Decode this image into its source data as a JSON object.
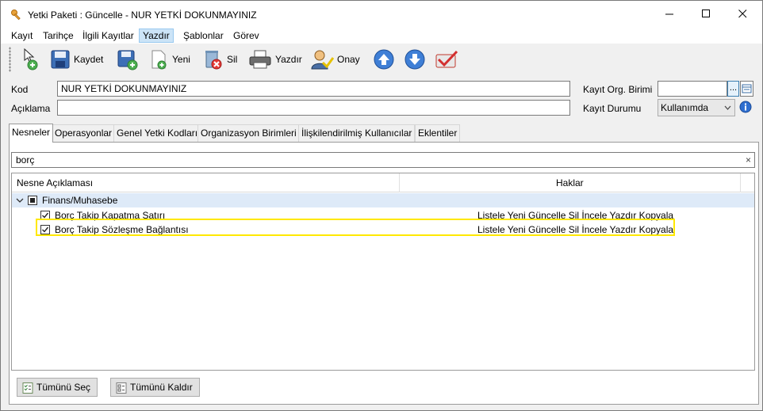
{
  "window": {
    "title": "Yetki Paketi : Güncelle - NUR YETKİ DOKUNMAYINIZ",
    "icons": {
      "app": "key-icon",
      "minimize": "minimize-icon",
      "maximize": "maximize-icon",
      "close": "close-icon"
    }
  },
  "menu": [
    {
      "label": "Kayıt"
    },
    {
      "label": "Tarihçe"
    },
    {
      "label": "İlgili Kayıtlar"
    },
    {
      "label": "Yazdır"
    },
    {
      "label": "Şablonlar"
    },
    {
      "label": "Görev"
    }
  ],
  "toolbar": {
    "save_label": "Kaydet",
    "new_label": "Yeni",
    "delete_label": "Sil",
    "print_label": "Yazdır",
    "approve_label": "Onay"
  },
  "form": {
    "kod_label": "Kod",
    "kod_value": "NUR YETKİ DOKUNMAYINIZ",
    "aciklama_label": "Açıklama",
    "aciklama_value": "",
    "org_label": "Kayıt Org. Birimi",
    "org_value": "",
    "org_button": "...",
    "durum_label": "Kayıt Durumu",
    "durum_value": "Kullanımda"
  },
  "tabs": [
    {
      "label": "Nesneler"
    },
    {
      "label": "Operasyonlar"
    },
    {
      "label": "Genel Yetki Kodları"
    },
    {
      "label": "Organizasyon Birimleri"
    },
    {
      "label": "İlişkilendirilmiş Kullanıcılar"
    },
    {
      "label": "Eklentiler"
    }
  ],
  "search": {
    "value": "borç",
    "clear": "×"
  },
  "grid": {
    "columns": [
      "Nesne Açıklaması",
      "Haklar"
    ],
    "group": {
      "label": "Finans/Muhasebe"
    },
    "rows": [
      {
        "name": "Borç Takip Kapatma Satırı",
        "rights": "Listele Yeni Güncelle Sil İncele Yazdır Kopyala"
      },
      {
        "name": "Borç Takip Sözleşme Bağlantısı",
        "rights": "Listele Yeni Güncelle Sil İncele Yazdır Kopyala"
      }
    ]
  },
  "buttons": {
    "select_all": "Tümünü Seç",
    "deselect_all": "Tümünü Kaldır"
  },
  "colors": {
    "highlight": "#ffe800",
    "group_row": "#deeaf8",
    "menu_active": "#cce4f7"
  }
}
